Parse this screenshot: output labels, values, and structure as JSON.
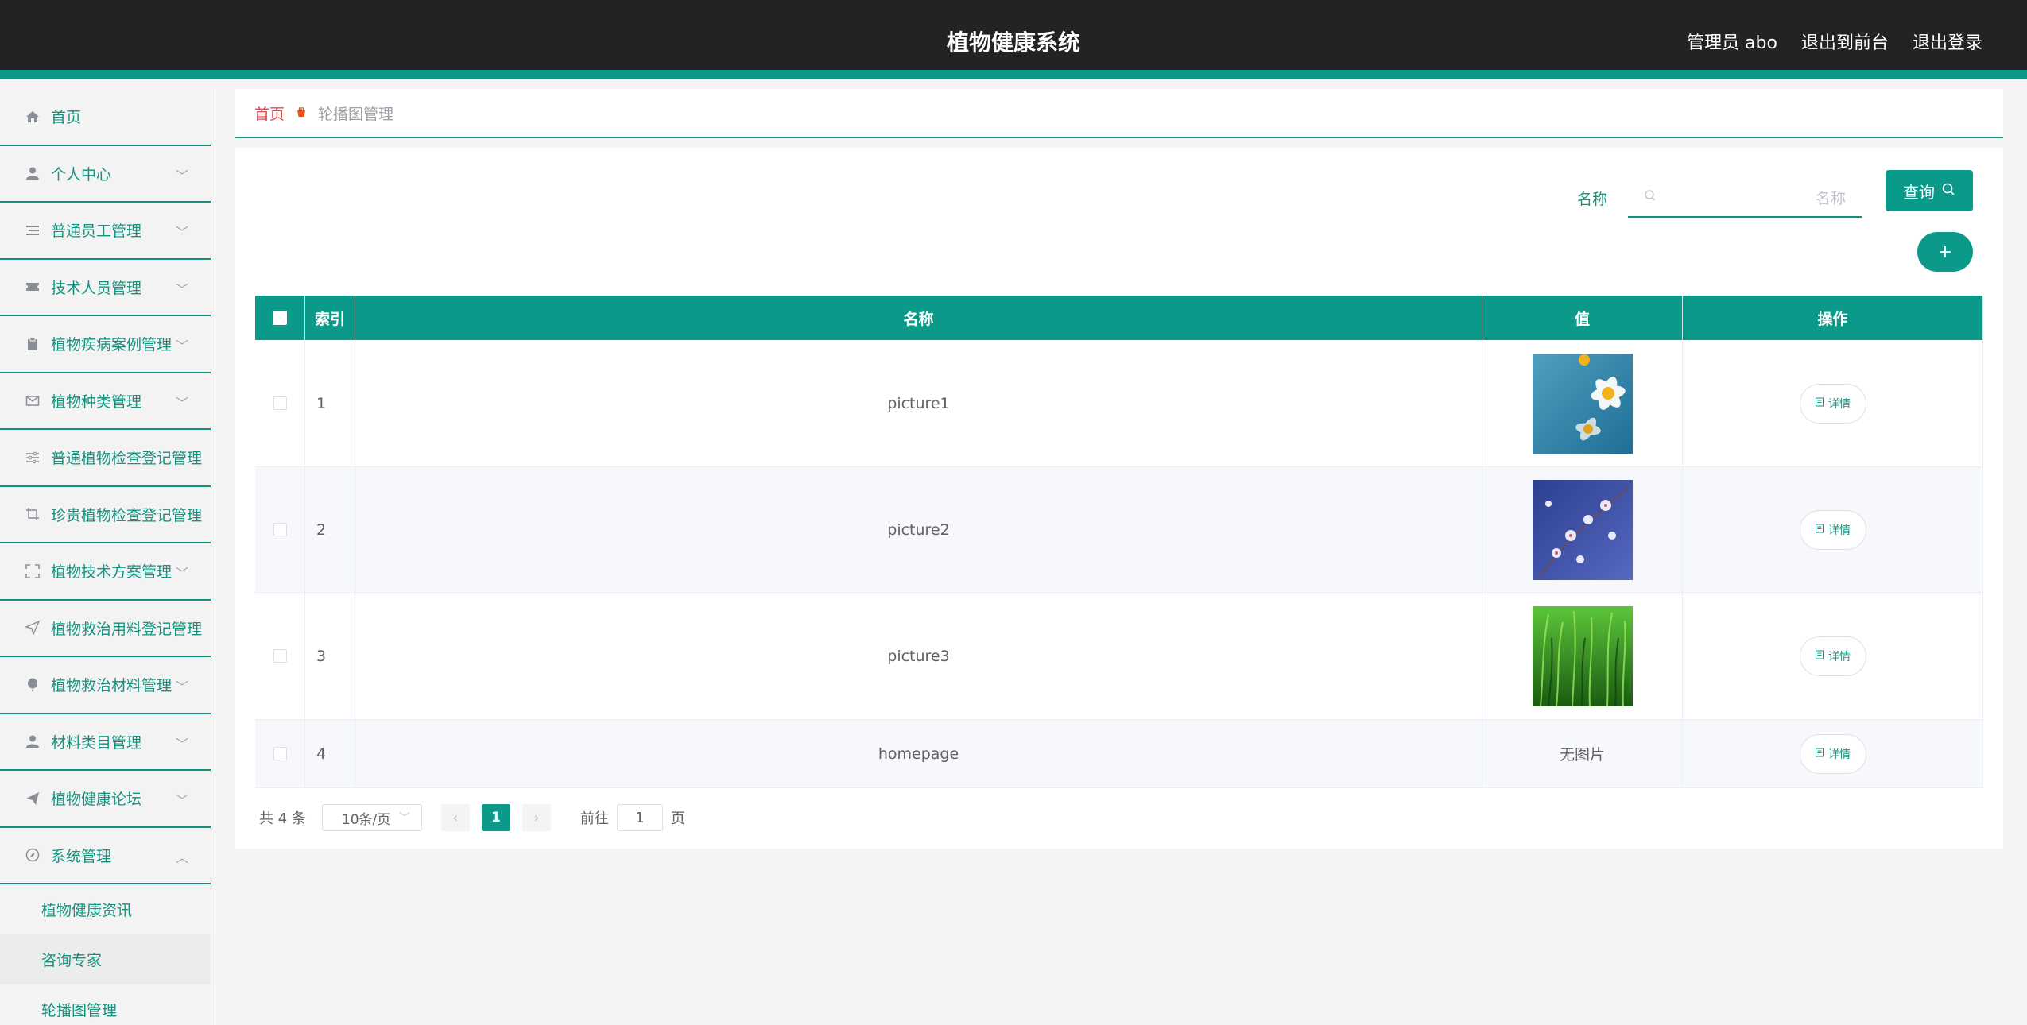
{
  "header": {
    "title": "植物健康系统",
    "user_label": "管理员 abo",
    "front_label": "退出到前台",
    "logout_label": "退出登录"
  },
  "sidebar": {
    "items": [
      {
        "label": "首页",
        "icon": "home-icon",
        "expandable": false
      },
      {
        "label": "个人中心",
        "icon": "user-icon",
        "expandable": true
      },
      {
        "label": "普通员工管理",
        "icon": "list-icon",
        "expandable": true
      },
      {
        "label": "技术人员管理",
        "icon": "ticket-icon",
        "expandable": true
      },
      {
        "label": "植物疾病案例管理",
        "icon": "clipboard-icon",
        "expandable": true
      },
      {
        "label": "植物种类管理",
        "icon": "mail-icon",
        "expandable": true
      },
      {
        "label": "普通植物检查登记管理",
        "icon": "sliders-icon",
        "expandable": false
      },
      {
        "label": "珍贵植物检查登记管理",
        "icon": "crop-icon",
        "expandable": false
      },
      {
        "label": "植物技术方案管理",
        "icon": "fullscreen-icon",
        "expandable": true
      },
      {
        "label": "植物救治用料登记管理",
        "icon": "send-icon",
        "expandable": false
      },
      {
        "label": "植物救治材料管理",
        "icon": "balloon-icon",
        "expandable": true
      },
      {
        "label": "材料类目管理",
        "icon": "user-icon",
        "expandable": true
      },
      {
        "label": "植物健康论坛",
        "icon": "paper-plane-icon",
        "expandable": true
      },
      {
        "label": "系统管理",
        "icon": "compass-icon",
        "expandable": true,
        "expanded": true
      }
    ],
    "sub_items": [
      "植物健康资讯",
      "咨询专家",
      "轮播图管理"
    ]
  },
  "breadcrumb": {
    "home": "首页",
    "current": "轮播图管理"
  },
  "search": {
    "label": "名称",
    "placeholder": "名称",
    "query_label": "查询",
    "add_label": "+"
  },
  "table": {
    "headers": [
      "索引",
      "名称",
      "值",
      "操作"
    ],
    "rows": [
      {
        "index": "1",
        "name": "picture1",
        "value": "",
        "image": "daisy",
        "action": "详情"
      },
      {
        "index": "2",
        "name": "picture2",
        "value": "",
        "image": "blossom",
        "action": "详情"
      },
      {
        "index": "3",
        "name": "picture3",
        "value": "",
        "image": "grass",
        "action": "详情"
      },
      {
        "index": "4",
        "name": "homepage",
        "value": "无图片",
        "image": "",
        "action": "详情"
      }
    ]
  },
  "pagination": {
    "total": "共 4 条",
    "page_size": "10条/页",
    "current_page": "1",
    "goto_prefix": "前往",
    "goto_value": "1",
    "goto_suffix": "页"
  },
  "colors": {
    "accent": "#0b9a8a",
    "header_bg": "#232323",
    "breadcrumb_home": "#e8434e"
  }
}
